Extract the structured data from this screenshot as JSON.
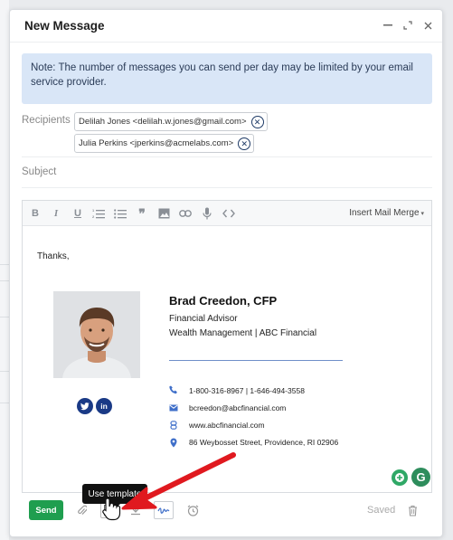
{
  "window": {
    "title": "New Message",
    "controls": [
      "minimize-icon",
      "expand-icon",
      "close-icon"
    ]
  },
  "note": {
    "text": "Note: The number of messages you can send per day may be limited by your email service provider."
  },
  "recipients": {
    "label": "Recipients",
    "chips": [
      "Delilah Jones <delilah.w.jones@gmail.com>",
      "Julia Perkins <jperkins@acmelabs.com>"
    ]
  },
  "subject": {
    "label": "Subject",
    "value": ""
  },
  "toolbar": {
    "icons": [
      "bold-icon",
      "italic-icon",
      "underline-icon",
      "numbered-list-icon",
      "bullet-list-icon",
      "quote-icon",
      "image-icon",
      "link-icon",
      "microphone-icon",
      "code-icon"
    ],
    "mail_merge_label": "Insert Mail Merge"
  },
  "body": {
    "greeting": "Thanks,"
  },
  "signature": {
    "name": "Brad Creedon, CFP",
    "role": "Financial Advisor",
    "company": "Wealth Management | ABC Financial",
    "phone": "1-800-316-8967  |  1-646-494-3558",
    "email": "bcreedon@abcfinancial.com",
    "website": "www.abcfinancial.com",
    "address": "86 Weybosset Street, Providence, RI 02906",
    "social": [
      "twitter-icon",
      "linkedin-icon"
    ],
    "accent_color": "#1a3a86"
  },
  "footer": {
    "send_label": "Send",
    "tooltip": "Use template",
    "saved_label": "Saved",
    "send_color": "#1f9e4f"
  }
}
